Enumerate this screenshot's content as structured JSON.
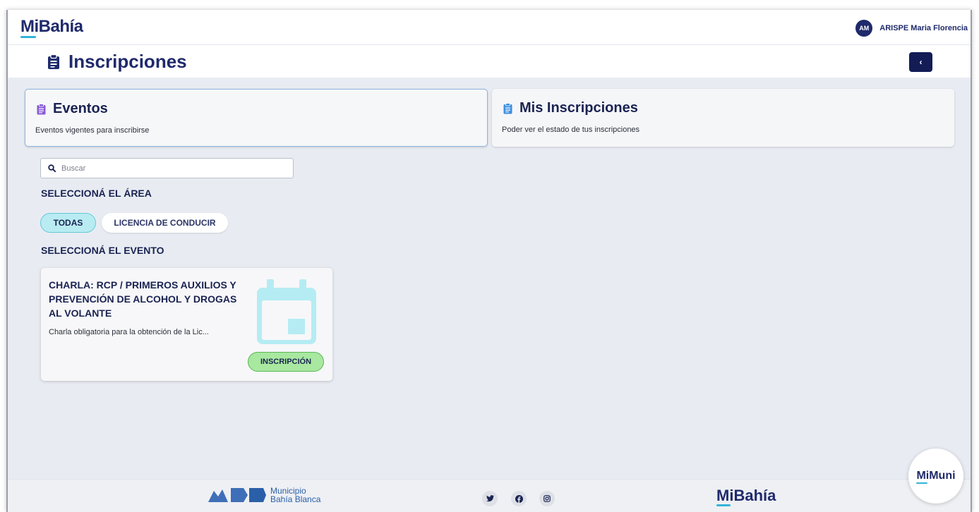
{
  "app": {
    "logo_mi": "Mi",
    "logo_rest": "Bahía"
  },
  "user": {
    "initials": "AM",
    "name": "ARISPE Maria Florencia"
  },
  "header": {
    "title": "Inscripciones",
    "back_label": "‹"
  },
  "tabs": [
    {
      "title": "Eventos",
      "description": "Eventos vigentes para inscribirse",
      "icon": "clipboard-icon",
      "icon_color": "#8a5cd6"
    },
    {
      "title": "Mis Inscripciones",
      "description": "Poder ver el estado de tus inscripciones",
      "icon": "clipboard-icon",
      "icon_color": "#3b8fe0"
    }
  ],
  "search": {
    "placeholder": "Buscar",
    "value": ""
  },
  "areas": {
    "title": "SELECCIONÁ EL ÁREA",
    "chips": [
      "TODAS",
      "LICENCIA DE CONDUCIR"
    ],
    "selected": "TODAS"
  },
  "events": {
    "title": "SELECCIONÁ EL EVENTO",
    "items": [
      {
        "title": "CHARLA: RCP / PRIMEROS AUXILIOS Y PREVENCIÓN DE ALCOHOL Y DROGAS AL VOLANTE",
        "description": "Charla obligatoria para la obtención de la Lic...",
        "button": "INSCRIPCIÓN",
        "icon": "calendar-icon"
      }
    ]
  },
  "footer": {
    "municipio_line1": "Municipio",
    "municipio_line2": "Bahía Blanca",
    "social": [
      "twitter-icon",
      "facebook-icon",
      "instagram-icon"
    ],
    "logo_mi": "Mi",
    "logo_rest": "Bahía"
  },
  "mimuni": {
    "mi": "Mi",
    "rest": "Muni"
  },
  "colors": {
    "navy": "#1f2a6b",
    "accent_cyan": "#32b4d8",
    "button_green": "#a8e8a0",
    "chip_active": "#b9ecf2"
  }
}
